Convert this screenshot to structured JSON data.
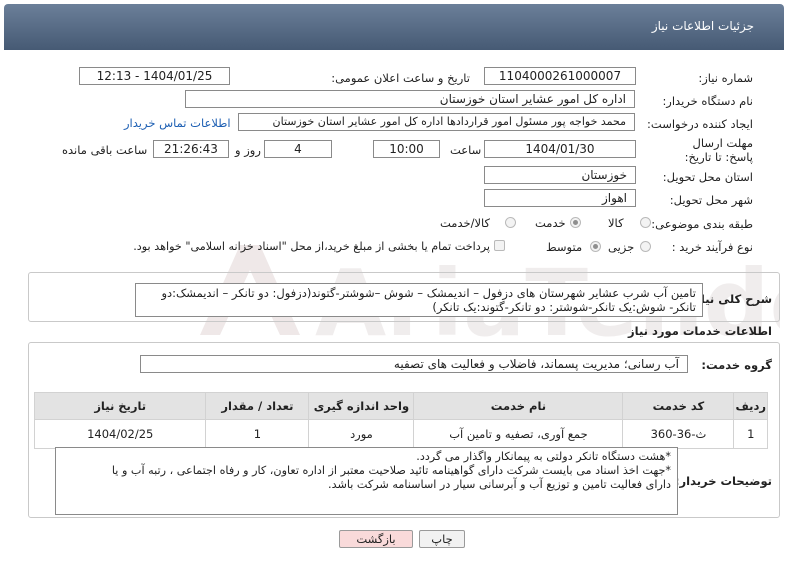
{
  "header": {
    "title": "جزئیات اطلاعات نیاز"
  },
  "form": {
    "need_number_label": "شماره نیاز:",
    "need_number": "1104000261000007",
    "announce_label": "تاریخ و ساعت اعلان عمومی:",
    "announce_value": "1404/01/25 - 12:13",
    "buyer_org_label": "نام دستگاه خریدار:",
    "buyer_org": "اداره کل امور عشایر استان خوزستان",
    "creator_label": "ایجاد کننده درخواست:",
    "creator": "محمد خواجه پور مسئول امور قراردادها اداره کل امور عشایر استان خوزستان",
    "contact_link": "اطلاعات تماس خریدار",
    "deadline_label": "مهلت ارسال پاسخ: تا تاریخ:",
    "deadline_date": "1404/01/30",
    "time_label": "ساعت",
    "deadline_time": "10:00",
    "days_value": "4",
    "days_label": "روز و",
    "remaining_time": "21:26:43",
    "remaining_label": "ساعت باقی مانده",
    "province_label": "استان محل تحویل:",
    "province": "خوزستان",
    "city_label": "شهر محل تحویل:",
    "city": "اهواز",
    "category_label": "طبقه بندی موضوعی:",
    "category_options": [
      "کالا",
      "خدمت",
      "کالا/خدمت"
    ],
    "purchase_type_label": "نوع فرآیند خرید :",
    "purchase_type_options": [
      "جزیی",
      "متوسط"
    ],
    "treasury_note": "پرداخت تمام یا بخشی از مبلغ خرید،از محل \"اسناد خزانه اسلامی\" خواهد بود."
  },
  "summary": {
    "label": "شرح کلی نیاز:",
    "text": "تامین آب شرب عشایر شهرستان های دزفول – اندیمشک – شوش –شوشتر-گتوند(دزفول: دو تانکر – اندیمشک:دو تانکر- شوش:یک تانکر-شوشتر: دو تانکر-گتوند:یک تانکر)"
  },
  "services": {
    "section_title": "اطلاعات خدمات مورد نیاز",
    "group_label": "گروه خدمت:",
    "group_value": "آب رسانی؛ مدیریت پسماند، فاضلاب و فعالیت های تصفیه",
    "columns": [
      "ردیف",
      "کد خدمت",
      "نام خدمت",
      "واحد اندازه گیری",
      "تعداد / مقدار",
      "تاریخ نیاز"
    ],
    "rows": [
      {
        "row": "1",
        "code": "ث-36-360",
        "name": "جمع آوری، تصفیه و تامین آب",
        "unit": "مورد",
        "qty": "1",
        "date": "1404/02/25"
      }
    ]
  },
  "buyer_notes": {
    "label": "توضیحات خریدار:",
    "text": "*هشت دستگاه تانکر دولتی به پیمانکار واگذار می گردد.\n*جهت اخذ اسناد می بایست شرکت دارای گواهینامه تائید صلاحیت معتبر از اداره تعاون، کار  و رفاه اجتماعی ، رتبه آب و یا\nدارای فعالیت تامین و توزیع آب و آبرسانی سیار در اساسنامه شرکت  باشد."
  },
  "buttons": {
    "print": "چاپ",
    "back": "بازگشت"
  },
  "colors": {
    "header": "#556a86",
    "back_button_bg": "#f9dada",
    "print_button_bg": "#f2f2f2",
    "link": "#1d5fb3"
  }
}
